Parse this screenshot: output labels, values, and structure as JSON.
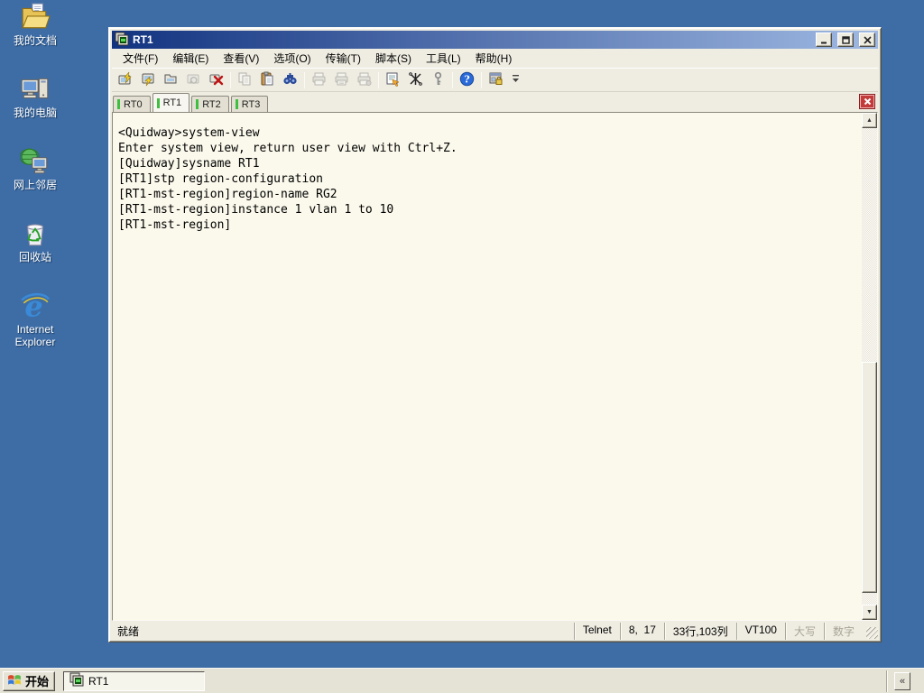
{
  "desktop": {
    "icons": [
      {
        "id": "my-documents",
        "icon": "my-documents-icon",
        "label": "我的文档"
      },
      {
        "id": "my-computer",
        "icon": "my-computer-icon",
        "label": "我的电脑"
      },
      {
        "id": "network-places",
        "icon": "network-places-icon",
        "label": "网上邻居"
      },
      {
        "id": "recycle-bin",
        "icon": "recycle-bin-icon",
        "label": "回收站"
      },
      {
        "id": "internet-explorer",
        "icon": "internet-explorer-icon",
        "label": "Internet Explorer"
      }
    ]
  },
  "window": {
    "title": "RT1",
    "controls": {
      "minimize": "minimize",
      "maximize": "maximize",
      "close": "close"
    },
    "menus": [
      {
        "id": "file",
        "label": "文件(F)"
      },
      {
        "id": "edit",
        "label": "编辑(E)"
      },
      {
        "id": "view",
        "label": "查看(V)"
      },
      {
        "id": "options",
        "label": "选项(O)"
      },
      {
        "id": "transfer",
        "label": "传输(T)"
      },
      {
        "id": "script",
        "label": "脚本(S)"
      },
      {
        "id": "tools",
        "label": "工具(L)"
      },
      {
        "id": "help",
        "label": "帮助(H)"
      }
    ],
    "toolbar": [
      {
        "id": "quick-connect",
        "icon": "quick-connect-icon",
        "enabled": true
      },
      {
        "id": "connect",
        "icon": "connect-icon",
        "enabled": true
      },
      {
        "id": "connect-in-tab",
        "icon": "connect-tab-icon",
        "enabled": true
      },
      {
        "id": "reconnect",
        "icon": "reconnect-icon",
        "enabled": false
      },
      {
        "id": "disconnect",
        "icon": "disconnect-icon",
        "enabled": true
      },
      {
        "sep": true
      },
      {
        "id": "copy",
        "icon": "copy-icon",
        "enabled": false
      },
      {
        "id": "paste",
        "icon": "paste-icon",
        "enabled": true
      },
      {
        "id": "find",
        "icon": "find-icon",
        "enabled": true
      },
      {
        "sep": true
      },
      {
        "id": "print",
        "icon": "print-icon",
        "enabled": false
      },
      {
        "id": "print-selection",
        "icon": "print-selection-icon",
        "enabled": false
      },
      {
        "id": "print-setup",
        "icon": "print-setup-icon",
        "enabled": false
      },
      {
        "sep": true
      },
      {
        "id": "session-options",
        "icon": "session-options-icon",
        "enabled": true
      },
      {
        "id": "keymap-editor",
        "icon": "keymap-icon",
        "enabled": true
      },
      {
        "id": "key-agent",
        "icon": "key-agent-icon",
        "enabled": true
      },
      {
        "sep": true
      },
      {
        "id": "help",
        "icon": "help-icon",
        "enabled": true
      },
      {
        "sep": true
      },
      {
        "id": "session-manager",
        "icon": "session-manager-icon",
        "enabled": true
      }
    ],
    "tabs": [
      {
        "id": "rt0",
        "label": "RT0",
        "active": false
      },
      {
        "id": "rt1",
        "label": "RT1",
        "active": true
      },
      {
        "id": "rt2",
        "label": "RT2",
        "active": false
      },
      {
        "id": "rt3",
        "label": "RT3",
        "active": false
      }
    ],
    "terminal_lines": [
      "<Quidway>system-view",
      "Enter system view, return user view with Ctrl+Z.",
      "[Quidway]sysname RT1",
      "[RT1]stp region-configuration",
      "[RT1-mst-region]region-name RG2",
      "[RT1-mst-region]instance 1 vlan 1 to 10",
      "[RT1-mst-region]"
    ],
    "status": {
      "ready": "就绪",
      "panels": [
        {
          "id": "protocol",
          "label": "Telnet",
          "dim": false
        },
        {
          "id": "cursor",
          "label": "8,  17",
          "dim": false
        },
        {
          "id": "term-size",
          "label": "33行,103列",
          "dim": false
        },
        {
          "id": "emulation",
          "label": "VT100",
          "dim": false
        },
        {
          "id": "caps-lock",
          "label": "大写",
          "dim": true
        },
        {
          "id": "num-lock",
          "label": "数字",
          "dim": true
        }
      ]
    }
  },
  "taskbar": {
    "start_label": "开始",
    "tasks": [
      {
        "id": "rt1",
        "label": "RT1"
      }
    ],
    "tray_collapse": "«"
  },
  "colors": {
    "desktop": "#3E6DA6",
    "title_gradient_left": "#123380",
    "title_gradient_right": "#9FB9E2",
    "chrome": "#EFEDE2",
    "terminal_bg": "#FBF9EC",
    "terminal_fg": "#000000",
    "tab_indicator": "#3FBF3F",
    "tab_close": "#C23A3A"
  }
}
